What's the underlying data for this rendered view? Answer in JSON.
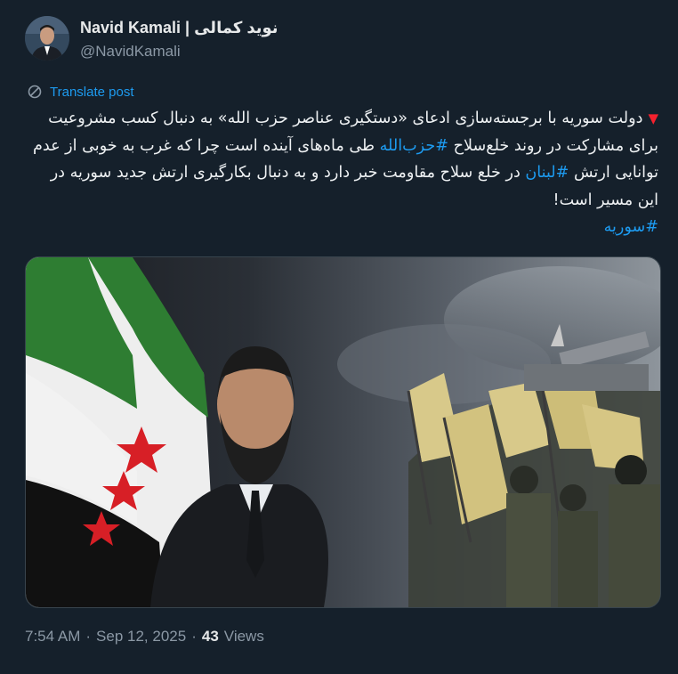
{
  "author": {
    "display_name": "Navid Kamali | نوید کمالی",
    "handle": "@NavidKamali"
  },
  "translate_label": "Translate post",
  "tweet": {
    "marker": "▼",
    "part1": "دولت سوریه با برجسته‌سازی ادعای «دستگیری عناصر حزب الله» به دنبال کسب مشروعیت برای مشارکت در روند خلع‌سلاح ",
    "tag1": "#حزب‌الله",
    "part2": " طی ماه‌های آینده است چرا که غرب به خوبی از عدم توانایی ارتش ",
    "tag2": "#لبنان",
    "part3": " در خلع سلاح مقاومت خبر دارد و به دنبال بکارگیری ارتش جدید سوریه در این مسیر است!",
    "tag3": "#سوریه"
  },
  "meta": {
    "time": "7:54 AM",
    "sep1": "·",
    "date": "Sep 12, 2025",
    "sep2": "·",
    "views_count": "43",
    "views_label": "Views"
  },
  "colors": {
    "background": "#15202b",
    "link": "#1d9bf0",
    "secondary_text": "#8b98a5",
    "flag_green": "#2e7d32",
    "flag_red": "#d71f26",
    "hezbollah_yellow": "#d8c98a"
  },
  "icons": {
    "translate": "translate-icon",
    "marker": "red-triangle-icon"
  }
}
